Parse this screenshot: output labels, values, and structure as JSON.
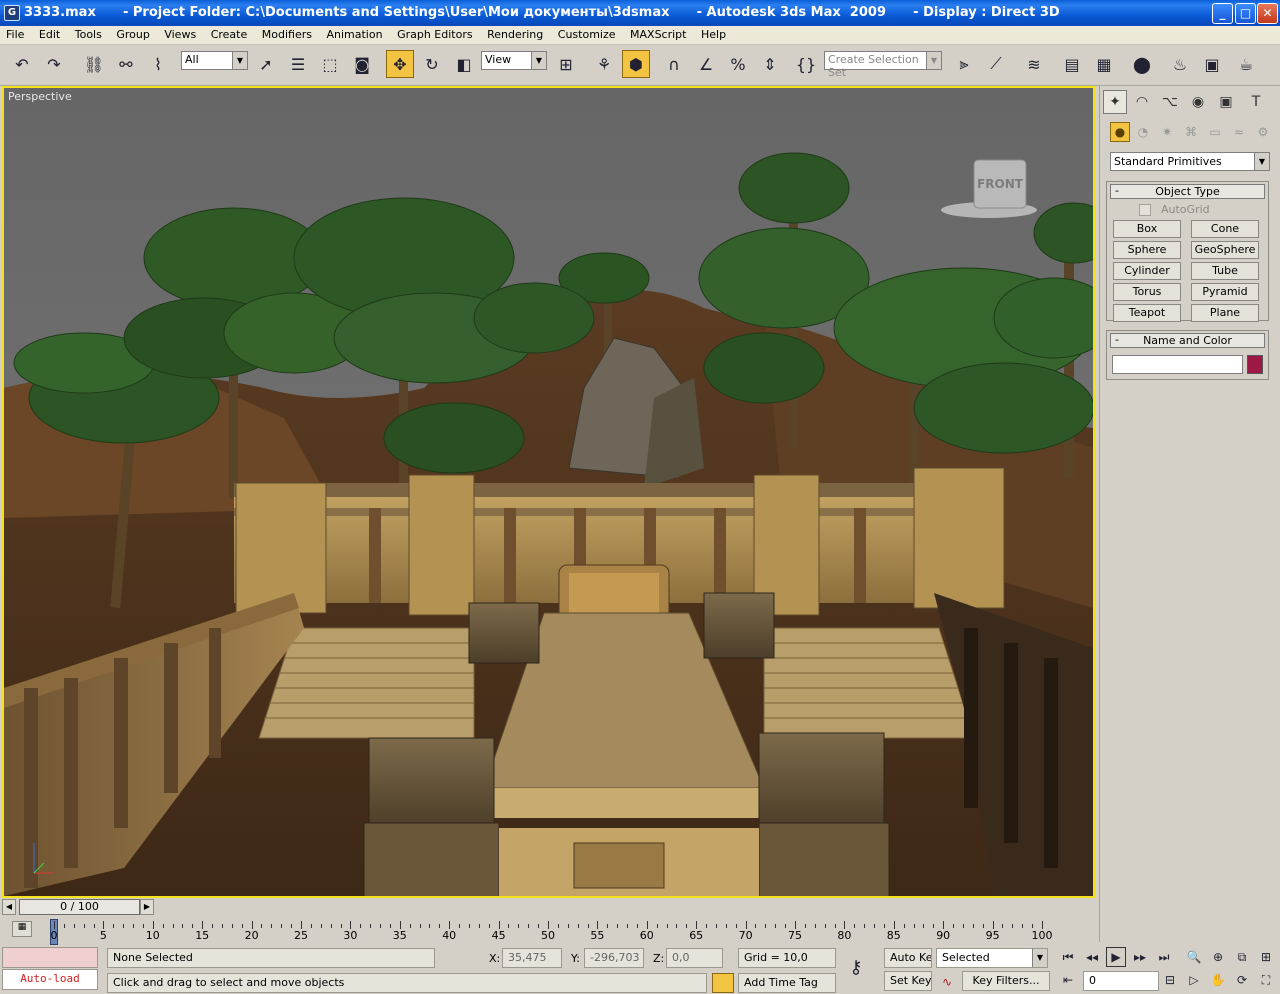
{
  "window": {
    "title": "3333.max      - Project Folder: C:\\Documents and Settings\\User\\Мои документы\\3dsmax      - Autodesk 3ds Max  2009      - Display : Direct 3D",
    "minimize": "_",
    "maximize": "□",
    "close": "✕"
  },
  "menu": [
    "File",
    "Edit",
    "Tools",
    "Group",
    "Views",
    "Create",
    "Modifiers",
    "Animation",
    "Graph Editors",
    "Rendering",
    "Customize",
    "MAXScript",
    "Help"
  ],
  "toolbar": {
    "selection_filter": "All",
    "ref_coord": "View",
    "named_selection_placeholder": "Create Selection Set"
  },
  "viewport": {
    "label": "Perspective",
    "viewcube_face": "FRONT"
  },
  "command_panel": {
    "category": "Standard Primitives",
    "object_type_title": "Object Type",
    "autogrid_label": "AutoGrid",
    "buttons": [
      "Box",
      "Cone",
      "Sphere",
      "GeoSphere",
      "Cylinder",
      "Tube",
      "Torus",
      "Pyramid",
      "Teapot",
      "Plane"
    ],
    "name_color_title": "Name and Color",
    "name_value": "",
    "object_color": "#9e1845"
  },
  "timeline": {
    "slider_label": "0 / 100",
    "ticks": [
      "0",
      "5",
      "10",
      "15",
      "20",
      "25",
      "30",
      "35",
      "40",
      "45",
      "50",
      "55",
      "60",
      "65",
      "70",
      "75",
      "80",
      "85",
      "90",
      "95",
      "100"
    ]
  },
  "status": {
    "maxscript_listener": "Auto-load",
    "selection_info": "None Selected",
    "prompt": "Click and drag to select and move objects",
    "x_label": "X:",
    "x_value": "35,475",
    "y_label": "Y:",
    "y_value": "-296,703",
    "z_label": "Z:",
    "z_value": "0,0",
    "grid": "Grid = 10,0",
    "add_time_tag": "Add Time Tag",
    "auto_key": "Auto Key",
    "set_key": "Set Key",
    "key_mode": "Selected",
    "key_filters": "Key Filters...",
    "current_frame": "0"
  }
}
